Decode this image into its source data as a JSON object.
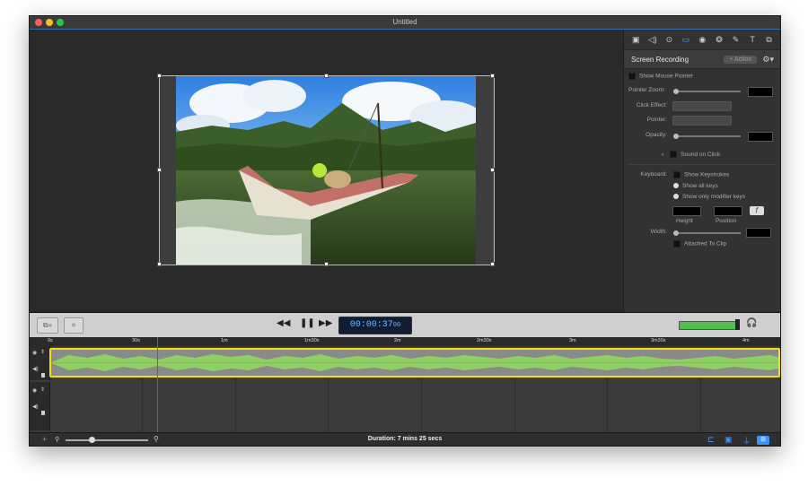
{
  "window": {
    "title": "Untitled"
  },
  "inspector": {
    "tabs": [
      "canvas-icon",
      "audio-icon",
      "cursor-icon",
      "screen-icon",
      "recording-icon",
      "effects-icon",
      "annotation-icon",
      "text-icon",
      "clip-icon"
    ],
    "active_tab": "screen-icon",
    "section_title": "Screen Recording",
    "action_button": "+ Action",
    "show_mouse_pointer": "Show Mouse Pointer",
    "pointer_zoom": "Pointer Zoom:",
    "click_effect": "Click Effect:",
    "pointer": "Pointer:",
    "opacity": "Opacity:",
    "sound_on_click": "Sound on Click",
    "keyboard": "Keyboard:",
    "show_keystrokes": "Show Keystrokes",
    "show_all_keys": "Show all keys",
    "show_modifier_keys": "Show only modifier keys",
    "height": "Height",
    "position": "Position",
    "width": "Width:",
    "attached_to_clip": "Attached To Clip"
  },
  "transport": {
    "timecode": "00:00:37",
    "frames": "00"
  },
  "timeline": {
    "ticks": [
      "0s",
      "30s",
      "1m",
      "1m30s",
      "2m",
      "2m30s",
      "3m",
      "3m30s",
      "4m"
    ]
  },
  "bottom": {
    "duration": "Duration: 7 mins 25 secs",
    "zoom_level": 0.3
  },
  "colors": {
    "accent": "#3b94ff",
    "selection": "#f4e10f",
    "waveform": "#8fcf63",
    "playhead": "#d9382c"
  }
}
